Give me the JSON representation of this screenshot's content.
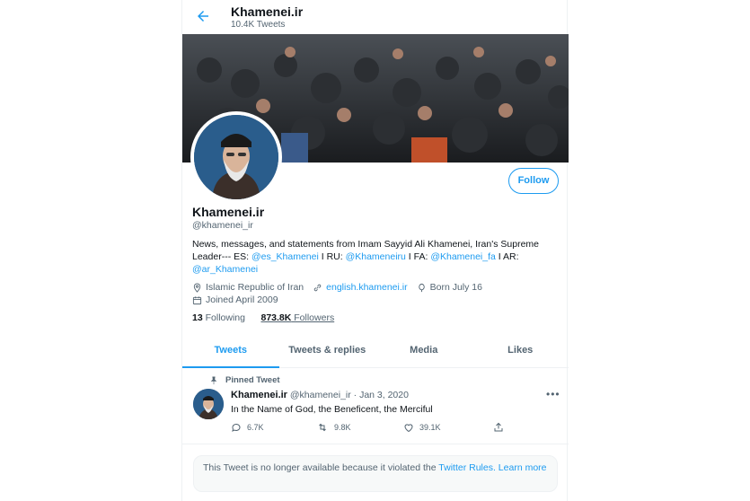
{
  "header": {
    "title": "Khamenei.ir",
    "tweet_count": "10.4K Tweets"
  },
  "profile": {
    "follow_label": "Follow",
    "name": "Khamenei.ir",
    "handle": "@khamenei_ir",
    "bio_line1": "News, messages, and statements from Imam Sayyid Ali Khamenei, Iran's Supreme",
    "bio_line2_a": "Leader--- ES: ",
    "bio_es": "@es_Khamenei",
    "bio_sep1": " I RU: ",
    "bio_ru": "@Khameneiru",
    "bio_sep2": " I FA: ",
    "bio_fa": "@Khamenei_fa",
    "bio_sep3": " I AR:",
    "bio_ar": "@ar_Khamenei",
    "location": "Islamic Republic of Iran",
    "website": "english.khamenei.ir",
    "birth": "Born July 16",
    "joined": "Joined April 2009",
    "following_count": "13",
    "following_label": " Following",
    "followers_count": "873.8K",
    "followers_label": " Followers"
  },
  "tabs": [
    "Tweets",
    "Tweets & replies",
    "Media",
    "Likes"
  ],
  "tweet": {
    "pinned_label": "Pinned Tweet",
    "author": "Khamenei.ir",
    "meta": " @khamenei_ir · Jan 3, 2020",
    "more": "•••",
    "text": "In the Name of God, the Beneficent, the Merciful",
    "replies": "6.7K",
    "retweets": "9.8K",
    "likes": "39.1K"
  },
  "notice": {
    "text": "This Tweet is no longer available because it violated the ",
    "rules_link": "Twitter Rules.",
    "learn_more": " Learn more"
  },
  "colors": {
    "accent": "#1d9bf0",
    "text": "#0f1419",
    "muted": "#536471"
  }
}
